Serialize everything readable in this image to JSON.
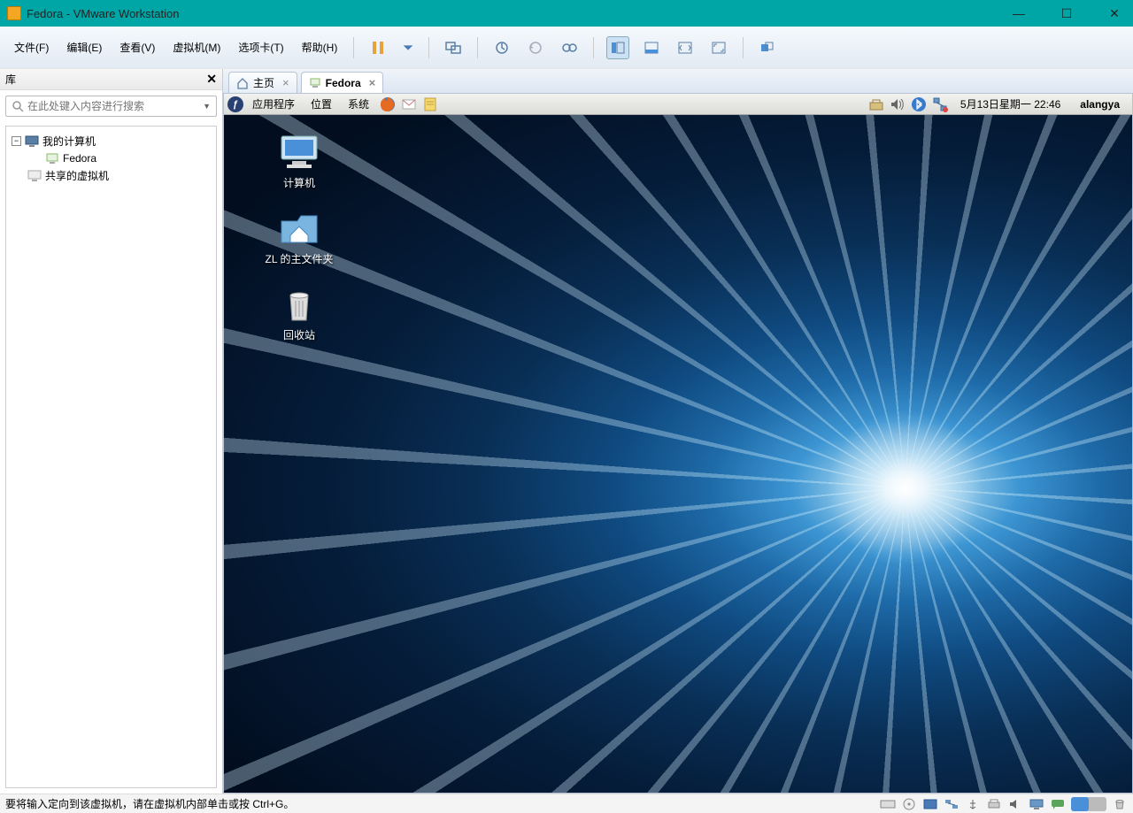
{
  "titlebar": {
    "title": "Fedora - VMware Workstation"
  },
  "menubar": {
    "file": "文件(F)",
    "edit": "编辑(E)",
    "view": "查看(V)",
    "vm": "虚拟机(M)",
    "tabs": "选项卡(T)",
    "help": "帮助(H)"
  },
  "library": {
    "header": "库",
    "search_placeholder": "在此处键入内容进行搜索",
    "my_computer": "我的计算机",
    "fedora": "Fedora",
    "shared_vms": "共享的虚拟机"
  },
  "vm_tabs": {
    "home": "主页",
    "fedora": "Fedora"
  },
  "fedora_panel": {
    "apps": "应用程序",
    "places": "位置",
    "system": "系统",
    "datetime": "5月13日星期一 22:46",
    "user": "alangya"
  },
  "desktop_icons": {
    "computer": "计算机",
    "home": "ZL 的主文件夹",
    "trash": "回收站"
  },
  "statusbar": {
    "text": "要将输入定向到该虚拟机，请在虚拟机内部单击或按 Ctrl+G。"
  }
}
